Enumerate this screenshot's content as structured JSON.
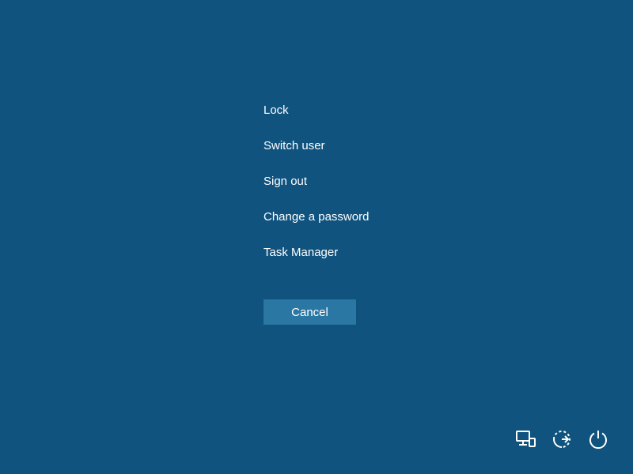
{
  "menu": {
    "items": [
      {
        "label": "Lock"
      },
      {
        "label": "Switch user"
      },
      {
        "label": "Sign out"
      },
      {
        "label": "Change a password"
      },
      {
        "label": "Task Manager"
      }
    ]
  },
  "cancel_label": "Cancel"
}
